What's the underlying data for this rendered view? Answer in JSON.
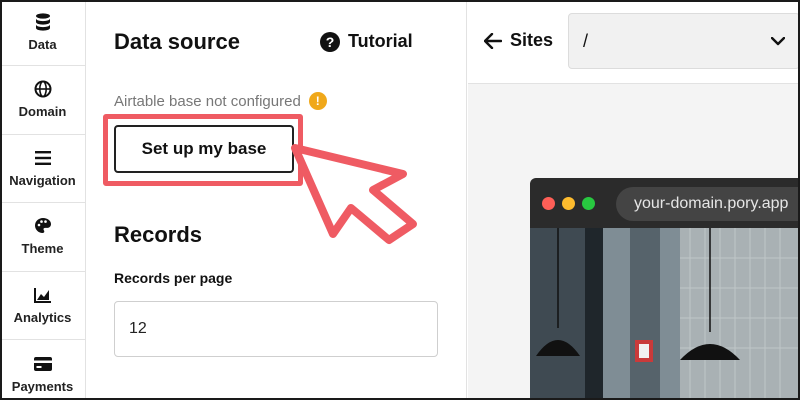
{
  "rail": {
    "items": [
      {
        "label": "Data",
        "icon": "database-icon"
      },
      {
        "label": "Domain",
        "icon": "globe-icon"
      },
      {
        "label": "Navigation",
        "icon": "menu-icon"
      },
      {
        "label": "Theme",
        "icon": "palette-icon"
      },
      {
        "label": "Analytics",
        "icon": "chart-icon"
      },
      {
        "label": "Payments",
        "icon": "credit-card-icon"
      }
    ]
  },
  "panel": {
    "title": "Data source",
    "tutorial_label": "Tutorial",
    "status_text": "Airtable base not configured",
    "status_icon": "!",
    "setup_button": "Set up my base",
    "records_title": "Records",
    "records_per_page_label": "Records per page",
    "records_per_page_value": "12"
  },
  "topbar": {
    "sites_label": "Sites",
    "path_value": "/"
  },
  "preview": {
    "url": "your-domain.pory.app"
  },
  "colors": {
    "accent_red": "#ef5b63",
    "warning": "#f0a81a",
    "dot_red": "#ff5f57",
    "dot_yellow": "#febc2e",
    "dot_green": "#28c840"
  }
}
